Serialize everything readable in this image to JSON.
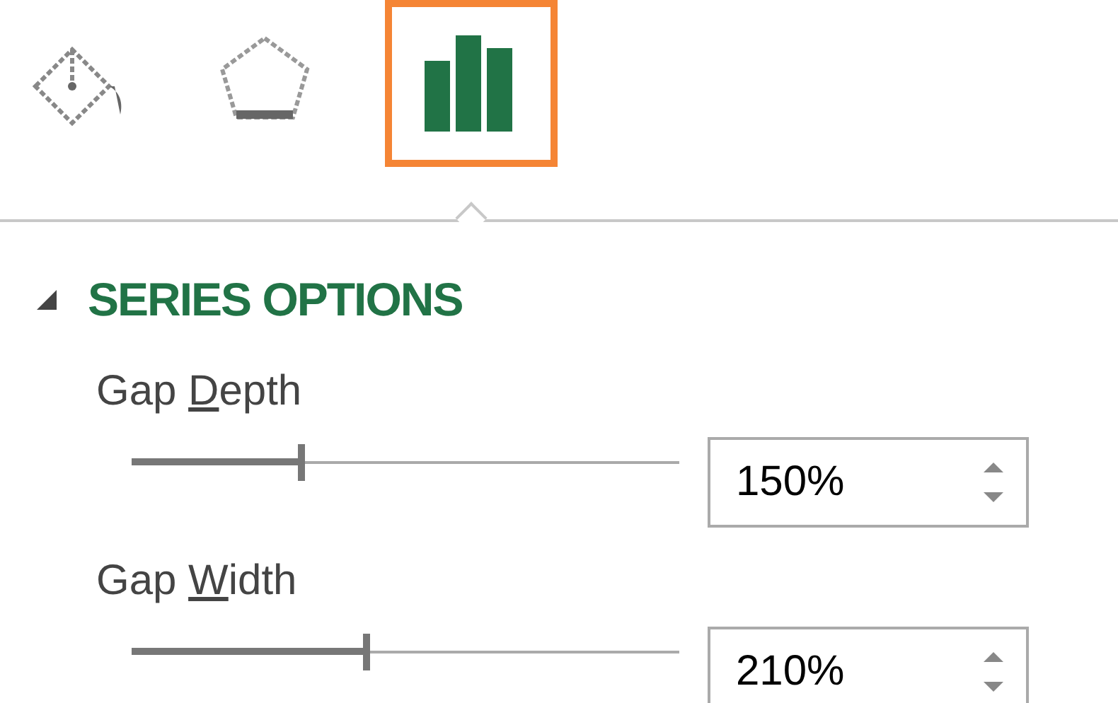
{
  "tabs": [
    {
      "kind": "fill",
      "selected": false
    },
    {
      "kind": "effects",
      "selected": false
    },
    {
      "kind": "series",
      "selected": true
    }
  ],
  "section": {
    "title": "SERIES OPTIONS",
    "expanded": true
  },
  "options": [
    {
      "label_parts": [
        "Gap ",
        "D",
        "epth"
      ],
      "level": 0.31,
      "value": "150%"
    },
    {
      "label_parts": [
        "Gap ",
        "W",
        "idth"
      ],
      "level": 0.43,
      "value": "210%"
    }
  ]
}
